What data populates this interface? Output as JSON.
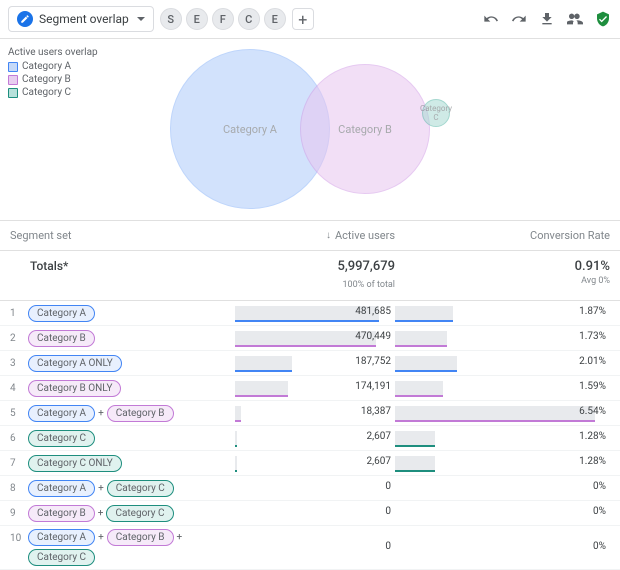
{
  "topbar": {
    "title": "Segment overlap",
    "chips": [
      "S",
      "E",
      "F",
      "C",
      "E"
    ]
  },
  "legend": {
    "title": "Active users overlap",
    "items": [
      {
        "label": "Category A",
        "fill": "#c5d9f8",
        "stroke": "#4285f4"
      },
      {
        "label": "Category B",
        "fill": "#e8cef0",
        "stroke": "#c27ad6"
      },
      {
        "label": "Category C",
        "fill": "#b7e1db",
        "stroke": "#1e8e7e"
      }
    ]
  },
  "chart_data": {
    "type": "venn",
    "title": "Active users overlap",
    "sets": [
      {
        "name": "Category A",
        "size": 481685
      },
      {
        "name": "Category B",
        "size": 470449
      },
      {
        "name": "Category C",
        "size": 2607
      }
    ],
    "intersections": [
      {
        "sets": [
          "Category A",
          "Category B"
        ],
        "size": 18387
      },
      {
        "sets": [
          "Category A",
          "Category C"
        ],
        "size": 0
      },
      {
        "sets": [
          "Category B",
          "Category C"
        ],
        "size": 0
      },
      {
        "sets": [
          "Category A",
          "Category B",
          "Category C"
        ],
        "size": 0
      }
    ],
    "only": [
      {
        "set": "Category A",
        "size": 187752
      },
      {
        "set": "Category B",
        "size": 174191
      },
      {
        "set": "Category C",
        "size": 2607
      }
    ]
  },
  "columns": {
    "set": "Segment set",
    "users": "Active users",
    "conv": "Conversion Rate"
  },
  "totals": {
    "label": "Totals*",
    "users": "5,997,679",
    "users_sub": "100% of total",
    "conv": "0.91%",
    "conv_sub": "Avg 0%"
  },
  "tags": {
    "a": {
      "label": "Category A",
      "border": "#4285f4",
      "bg": "#e8f0fe"
    },
    "b": {
      "label": "Category B",
      "border": "#c27ad6",
      "bg": "#f6eaf9"
    },
    "c": {
      "label": "Category C",
      "border": "#1e8e7e",
      "bg": "#e0f2ef"
    },
    "a_only": {
      "label": "Category A ONLY",
      "border": "#4285f4",
      "bg": "#e8f0fe"
    },
    "b_only": {
      "label": "Category B ONLY",
      "border": "#c27ad6",
      "bg": "#f6eaf9"
    },
    "c_only": {
      "label": "Category C ONLY",
      "border": "#1e8e7e",
      "bg": "#e0f2ef"
    }
  },
  "rows": [
    {
      "n": "1",
      "tags": [
        "a"
      ],
      "users": "481,685",
      "bar": 96,
      "color": "#4285f4",
      "conv": "1.87%",
      "cbar": 29
    },
    {
      "n": "2",
      "tags": [
        "b"
      ],
      "users": "470,449",
      "bar": 94,
      "color": "#c27ad6",
      "conv": "1.73%",
      "cbar": 26
    },
    {
      "n": "3",
      "tags": [
        "a_only"
      ],
      "users": "187,752",
      "bar": 38,
      "color": "#4285f4",
      "conv": "2.01%",
      "cbar": 31
    },
    {
      "n": "4",
      "tags": [
        "b_only"
      ],
      "users": "174,191",
      "bar": 35,
      "color": "#c27ad6",
      "conv": "1.59%",
      "cbar": 24
    },
    {
      "n": "5",
      "tags": [
        "a",
        "b"
      ],
      "users": "18,387",
      "bar": 4,
      "color": "#c27ad6",
      "conv": "6.54%",
      "cbar": 100
    },
    {
      "n": "6",
      "tags": [
        "c"
      ],
      "users": "2,607",
      "bar": 1,
      "color": "#1e8e7e",
      "conv": "1.28%",
      "cbar": 20
    },
    {
      "n": "7",
      "tags": [
        "c_only"
      ],
      "users": "2,607",
      "bar": 1,
      "color": "#1e8e7e",
      "conv": "1.28%",
      "cbar": 20
    },
    {
      "n": "8",
      "tags": [
        "a",
        "c"
      ],
      "users": "0",
      "bar": 0,
      "color": "#1e8e7e",
      "conv": "0%",
      "cbar": 0
    },
    {
      "n": "9",
      "tags": [
        "b",
        "c"
      ],
      "users": "0",
      "bar": 0,
      "color": "#1e8e7e",
      "conv": "0%",
      "cbar": 0
    },
    {
      "n": "10",
      "tags": [
        "a",
        "b",
        "c"
      ],
      "users": "0",
      "bar": 0,
      "color": "#1e8e7e",
      "conv": "0%",
      "cbar": 0
    }
  ]
}
